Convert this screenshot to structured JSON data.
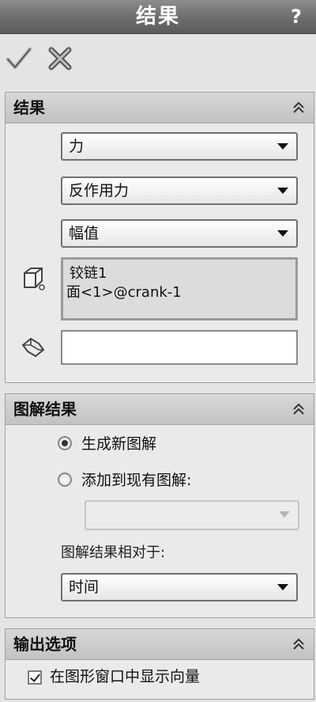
{
  "titlebar": {
    "title": "结果",
    "help": "?"
  },
  "results_group": {
    "header": "结果",
    "dropdown_1": "力",
    "dropdown_2": "反作用力",
    "dropdown_3": "幅值",
    "selection": {
      "line1": "铰链1",
      "line2": "面<1>@crank-1"
    },
    "second_selection_value": ""
  },
  "plot_group": {
    "header": "图解结果",
    "radio_new": "生成新图解",
    "radio_add": "添加到现有图解:",
    "existing_plot_value": "",
    "relative_label": "图解结果相对于:",
    "relative_value": "时间"
  },
  "output_group": {
    "header": "输出选项",
    "show_vector": "在图形窗口中显示向量"
  }
}
